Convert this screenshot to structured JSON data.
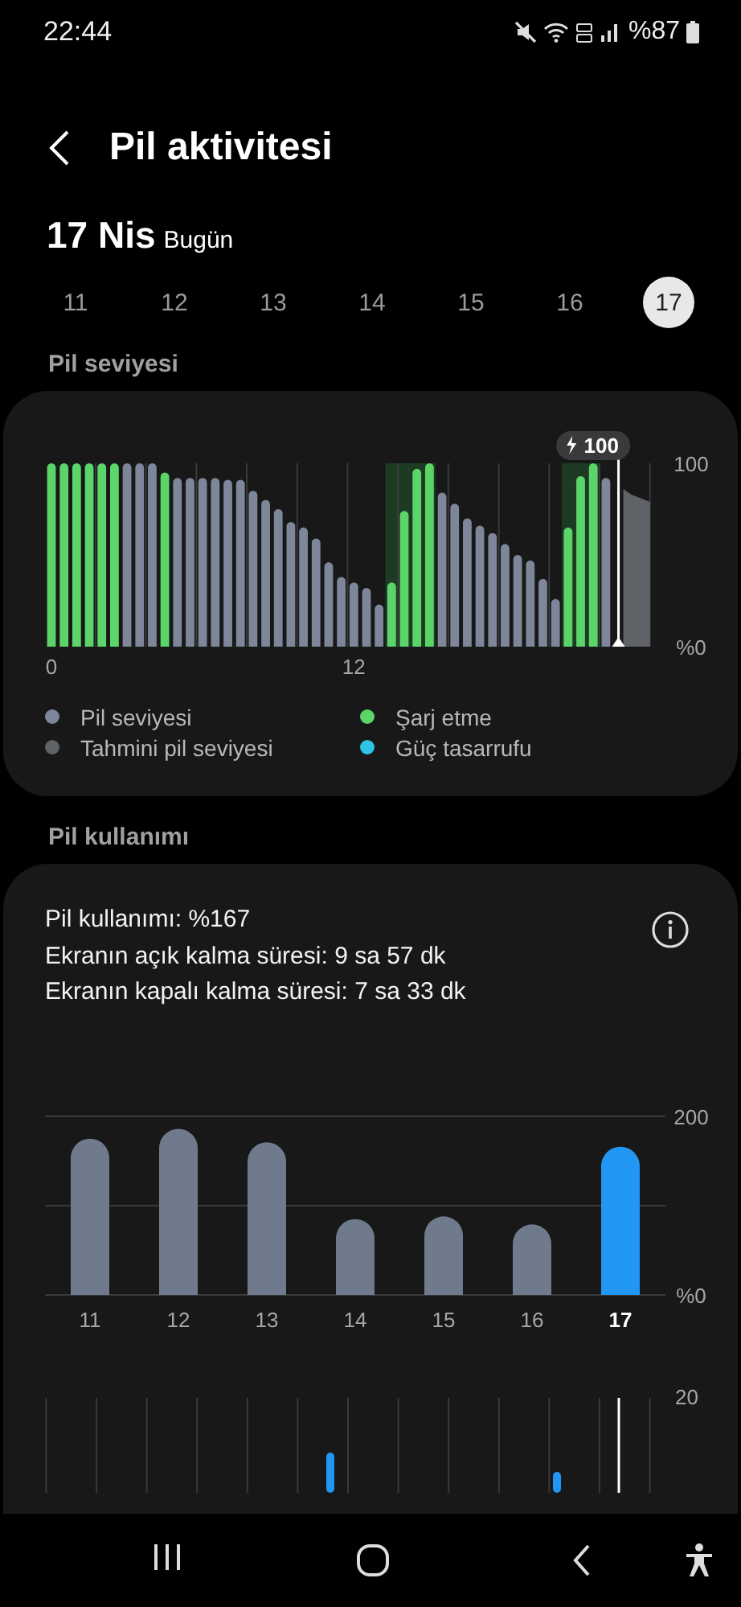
{
  "status_bar": {
    "time": "22:44",
    "battery": "%87"
  },
  "header": {
    "title": "Pil aktivitesi"
  },
  "date_heading": {
    "date": "17 Nis",
    "day": "Bugün"
  },
  "dates": [
    {
      "label": "11",
      "selected": false
    },
    {
      "label": "12",
      "selected": false
    },
    {
      "label": "13",
      "selected": false
    },
    {
      "label": "14",
      "selected": false
    },
    {
      "label": "15",
      "selected": false
    },
    {
      "label": "16",
      "selected": false
    },
    {
      "label": "17",
      "selected": true
    }
  ],
  "battery_level": {
    "heading": "Pil seviyesi",
    "chart_data": {
      "type": "bar",
      "stacked": true,
      "x": [
        0,
        0.5,
        1,
        1.5,
        2,
        2.5,
        3,
        3.5,
        4,
        4.5,
        5,
        5.5,
        6,
        6.5,
        7,
        7.5,
        8,
        8.5,
        9,
        9.5,
        10,
        10.5,
        11,
        11.5,
        12,
        12.5,
        13,
        13.5,
        14,
        14.5,
        15,
        15.5,
        16,
        16.5,
        17,
        17.5,
        18,
        18.5,
        19,
        19.5,
        20,
        20.5,
        21,
        21.5,
        22,
        22.5,
        23,
        23.5
      ],
      "series": [
        {
          "name": "Pil seviyesi",
          "color": "#7d8799",
          "values": [
            null,
            null,
            null,
            null,
            null,
            null,
            100,
            100,
            100,
            null,
            92,
            92,
            92,
            92,
            91,
            91,
            85,
            80,
            75,
            68,
            65,
            59,
            46,
            38,
            35,
            32,
            23,
            null,
            null,
            null,
            null,
            84,
            78,
            70,
            66,
            62,
            56,
            50,
            47,
            37,
            26,
            null,
            null,
            null,
            92,
            null,
            null,
            null
          ]
        },
        {
          "name": "Şarj etme",
          "color": "#5bd46a",
          "values": [
            100,
            100,
            100,
            100,
            100,
            100,
            null,
            null,
            null,
            95,
            null,
            null,
            null,
            null,
            null,
            null,
            null,
            null,
            null,
            null,
            null,
            null,
            null,
            null,
            null,
            null,
            null,
            35,
            74,
            97,
            100,
            null,
            null,
            null,
            null,
            null,
            null,
            null,
            null,
            null,
            null,
            65,
            93,
            100,
            null,
            null,
            null,
            null
          ]
        },
        {
          "name": "Tahmini pil seviyesi",
          "type": "area",
          "color": "#5f6368",
          "values": [
            null,
            null,
            null,
            null,
            null,
            null,
            null,
            null,
            null,
            null,
            null,
            null,
            null,
            null,
            null,
            null,
            null,
            null,
            null,
            null,
            null,
            null,
            null,
            null,
            null,
            null,
            null,
            null,
            null,
            null,
            null,
            null,
            null,
            null,
            null,
            null,
            null,
            null,
            null,
            null,
            null,
            null,
            null,
            null,
            null,
            86,
            83,
            79
          ]
        },
        {
          "name": "Güç tasarrufu",
          "color": "#2ec4e8",
          "values": [
            null,
            null,
            null,
            null,
            null,
            null,
            null,
            null,
            null,
            null,
            null,
            null,
            null,
            null,
            null,
            null,
            null,
            null,
            null,
            null,
            null,
            null,
            null,
            null,
            null,
            null,
            null,
            null,
            null,
            null,
            null,
            null,
            null,
            null,
            null,
            null,
            null,
            null,
            null,
            null,
            null,
            null,
            null,
            null,
            null,
            null,
            null,
            null
          ]
        }
      ],
      "xlim": [
        -0.25,
        23.75
      ],
      "ylim": [
        0,
        100
      ],
      "yticks": [
        {
          "value": 0,
          "label": "%0"
        },
        {
          "value": 100,
          "label": "100"
        }
      ],
      "xticks": [
        0,
        12
      ],
      "annotations": [
        "100"
      ],
      "bands": [
        {
          "axis": "x",
          "from": 13.25,
          "to": 15.25
        },
        {
          "axis": "x",
          "from": 20.25,
          "to": 21.75
        }
      ],
      "ref_lines": [
        {
          "axis": "x",
          "value": 22.5
        }
      ]
    }
  },
  "battery_usage": {
    "heading": "Pil kullanımı",
    "lines": [
      "Pil kullanımı: %167",
      "Ekranın açık kalma süresi: 9 sa 57 dk",
      "Ekranın kapalı kalma süresi: 7 sa 33 dk"
    ],
    "chart_data": {
      "type": "bar",
      "categories": [
        "11",
        "12",
        "13",
        "14",
        "15",
        "16",
        "17"
      ],
      "stacked": true,
      "series": [
        {
          "color": "#6f7a8c",
          "values": [
            175,
            186,
            171,
            85,
            88,
            79,
            null
          ]
        },
        {
          "color": "#2196f3",
          "values": [
            null,
            null,
            null,
            null,
            null,
            null,
            166
          ]
        }
      ],
      "ylim": [
        0,
        200
      ],
      "yticks": [
        {
          "value": 0,
          "label": "%0"
        },
        {
          "value": 200,
          "label": "200"
        }
      ],
      "ref_lines": [
        {
          "axis": "y",
          "value": 100
        }
      ]
    },
    "hourly_tick": "20"
  }
}
